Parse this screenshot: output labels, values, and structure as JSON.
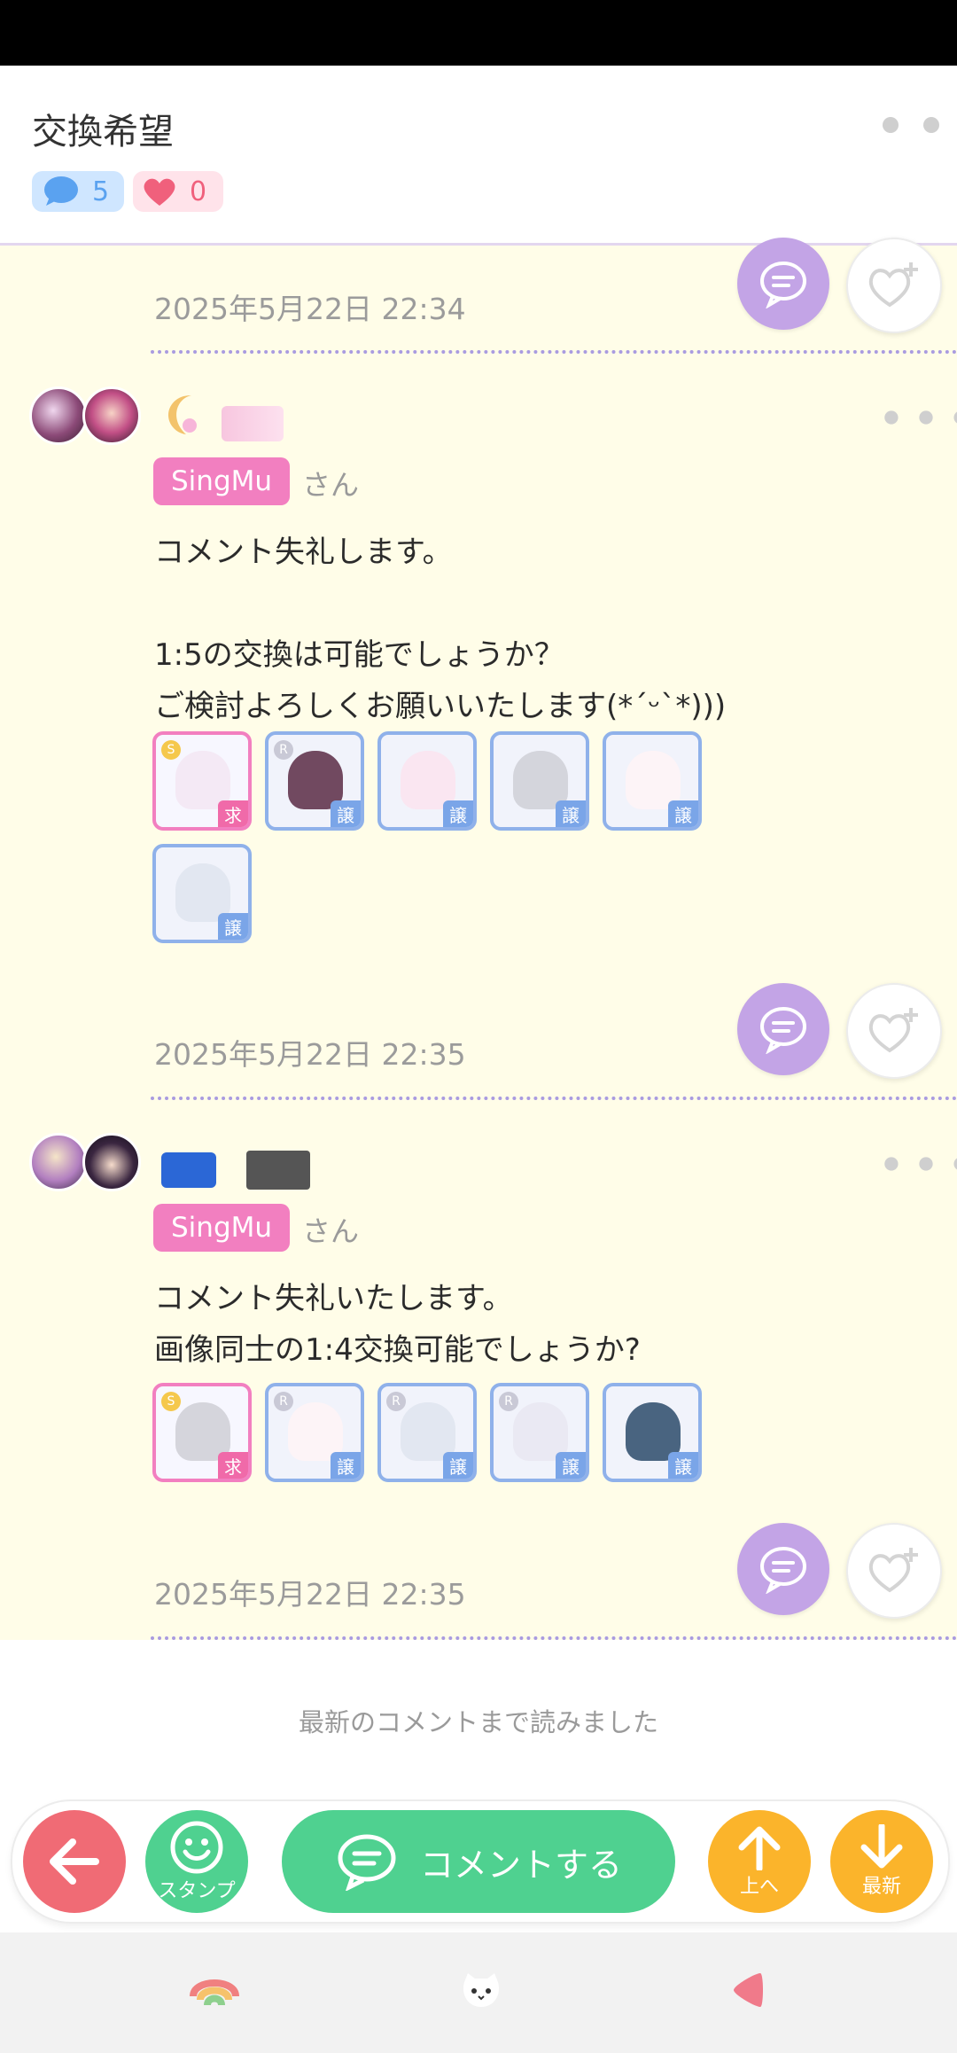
{
  "header": {
    "title": "交換希望",
    "comment_count": "5",
    "like_count": "0"
  },
  "first_block": {
    "timestamp": "2025年5月22日 22:34"
  },
  "comments": [
    {
      "tag": "SingMu",
      "suffix": "さん",
      "body": "コメント失礼します。\n\n1:5の交換は可能でしょうか？\nご検討よろしくお願いいたします(*ˊᵕˋ*)))",
      "items": [
        {
          "label": "求",
          "type": "want",
          "coin": "S"
        },
        {
          "label": "譲",
          "type": "give",
          "coin": "R"
        },
        {
          "label": "譲",
          "type": "give",
          "coin": ""
        },
        {
          "label": "譲",
          "type": "give",
          "coin": ""
        },
        {
          "label": "譲",
          "type": "give",
          "coin": ""
        },
        {
          "label": "譲",
          "type": "give",
          "coin": ""
        }
      ],
      "timestamp": "2025年5月22日 22:35"
    },
    {
      "tag": "SingMu",
      "suffix": "さん",
      "body": "コメント失礼いたします。\n画像同士の1:4交換可能でしょうか?",
      "items": [
        {
          "label": "求",
          "type": "want",
          "coin": "S"
        },
        {
          "label": "譲",
          "type": "give",
          "coin": "R"
        },
        {
          "label": "譲",
          "type": "give",
          "coin": "R"
        },
        {
          "label": "譲",
          "type": "give",
          "coin": "R"
        },
        {
          "label": "譲",
          "type": "give",
          "coin": ""
        }
      ],
      "timestamp": "2025年5月22日 22:35"
    }
  ],
  "footer": {
    "read_all": "最新のコメントまで読みました",
    "stamp_label": "スタンプ",
    "comment_button": "コメントする",
    "up_label": "上へ",
    "latest_label": "最新"
  },
  "colors": {
    "accent_purple": "#c3a4e6",
    "tag_pink": "#f27fc0",
    "green": "#4fd190",
    "orange": "#fbb42b",
    "red": "#f06b75"
  }
}
